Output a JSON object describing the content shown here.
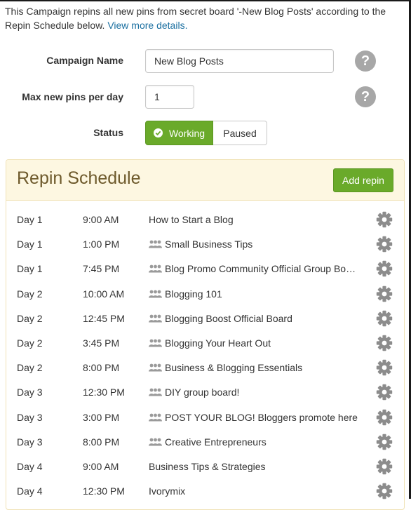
{
  "intro": {
    "text": "This Campaign repins all new pins from secret board '-New Blog Posts' according to the Repin Schedule below.",
    "link": "View more details."
  },
  "form": {
    "campaign_name_label": "Campaign Name",
    "campaign_name_value": "New Blog Posts",
    "max_pins_label": "Max new pins per day",
    "max_pins_value": "1",
    "status_label": "Status",
    "status_working": "Working",
    "status_paused": "Paused",
    "status_selected": "Working",
    "help_glyph": "?"
  },
  "schedule": {
    "title": "Repin Schedule",
    "add_button": "Add repin",
    "rows": [
      {
        "day": "Day 1",
        "time": "9:00 AM",
        "board": "How to Start a Blog",
        "group": false
      },
      {
        "day": "Day 1",
        "time": "1:00 PM",
        "board": "Small Business Tips",
        "group": true
      },
      {
        "day": "Day 1",
        "time": "7:45 PM",
        "board": "Blog Promo Community Official Group Bo…",
        "group": true
      },
      {
        "day": "Day 2",
        "time": "10:00 AM",
        "board": "Blogging 101",
        "group": true
      },
      {
        "day": "Day 2",
        "time": "12:45 PM",
        "board": "Blogging Boost Official Board",
        "group": true
      },
      {
        "day": "Day 2",
        "time": "3:45 PM",
        "board": "Blogging Your Heart Out",
        "group": true
      },
      {
        "day": "Day 2",
        "time": "8:00 PM",
        "board": "Business & Blogging Essentials",
        "group": true
      },
      {
        "day": "Day 3",
        "time": "12:30 PM",
        "board": "DIY group board!",
        "group": true
      },
      {
        "day": "Day 3",
        "time": "3:00 PM",
        "board": "POST YOUR BLOG! Bloggers promote here",
        "group": true
      },
      {
        "day": "Day 3",
        "time": "8:00 PM",
        "board": "Creative Entrepreneurs",
        "group": true
      },
      {
        "day": "Day 4",
        "time": "9:00 AM",
        "board": "Business Tips & Strategies",
        "group": false
      },
      {
        "day": "Day 4",
        "time": "12:30 PM",
        "board": "Ivorymix",
        "group": false
      }
    ]
  },
  "icons": {
    "help": "help-icon",
    "check": "check-circle-icon",
    "group_board": "group-board-icon",
    "settings": "gear-icon"
  },
  "colors": {
    "accent_green": "#6aaa2a",
    "link_blue": "#1a6fa0",
    "panel_header_bg": "#fdf7e1",
    "title_brown": "#6e5a2c",
    "icon_gray": "#a7a7a7"
  }
}
